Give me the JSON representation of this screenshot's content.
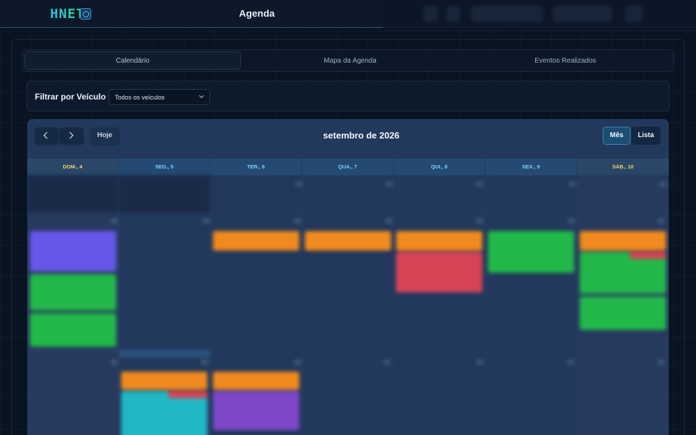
{
  "app": {
    "logo_text": "HNET",
    "title": "Agenda"
  },
  "tabs": [
    {
      "label": "Calendário",
      "active": true
    },
    {
      "label": "Mapa da Agenda",
      "active": false
    },
    {
      "label": "Eventos Realizados",
      "active": false
    }
  ],
  "filter": {
    "label": "Filtrar por Veículo",
    "selected": "Todos os veículos"
  },
  "calendar": {
    "today_label": "Hoje",
    "title": "setembro de 2026",
    "views": {
      "month": "Mês",
      "list": "Lista",
      "active": "month"
    },
    "day_headers": [
      {
        "label": "DOM., 4",
        "weekend": true
      },
      {
        "label": "SEG., 5",
        "weekend": false
      },
      {
        "label": "TER., 6",
        "weekend": false
      },
      {
        "label": "QUA., 7",
        "weekend": false
      },
      {
        "label": "QUI., 8",
        "weekend": false
      },
      {
        "label": "SEX., 9",
        "weekend": false
      },
      {
        "label": "SÁB., 10",
        "weekend": true
      }
    ],
    "event_colors": {
      "purple": "#6657e8",
      "green": "#22b84a",
      "orange": "#f08a1e",
      "red": "#d94356",
      "teal": "#1fb8c4",
      "violet": "#7d47c8"
    }
  },
  "colors": {
    "background": "#0a1322",
    "calendar_bg": "#22385c",
    "accent": "#7fd3ff",
    "weekend_header": "#f7d36a"
  }
}
